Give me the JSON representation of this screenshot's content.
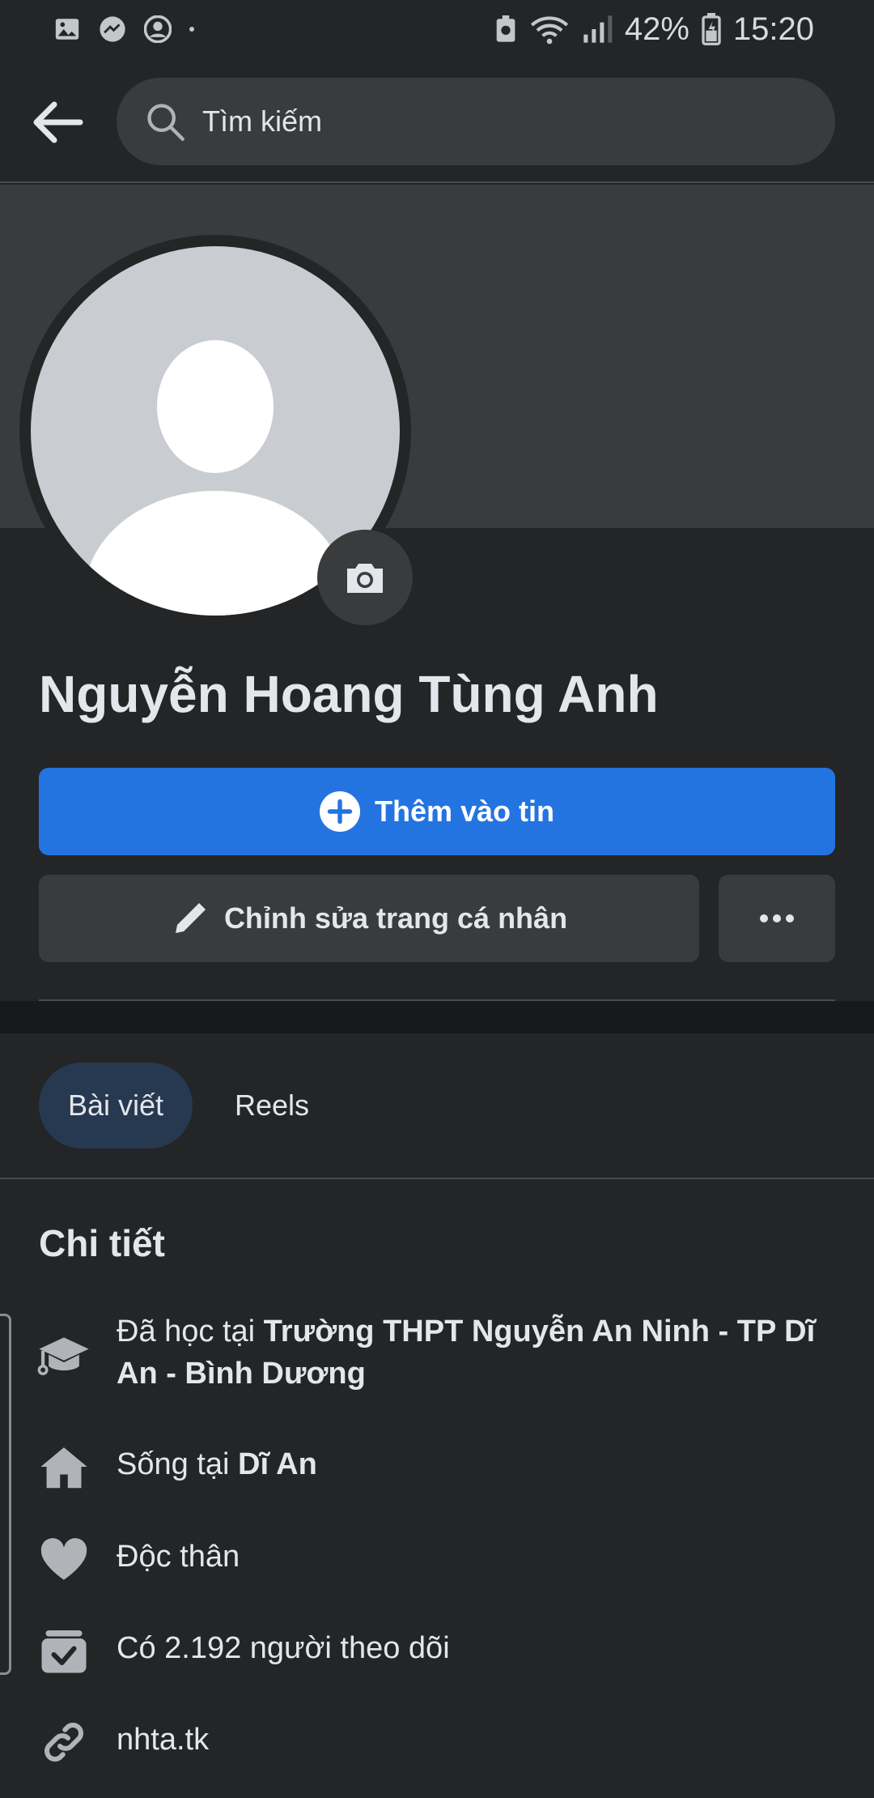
{
  "status_bar": {
    "battery": "42%",
    "time": "15:20"
  },
  "search": {
    "placeholder": "Tìm kiếm"
  },
  "profile": {
    "name": "Nguyễn Hoang Tùng Anh"
  },
  "actions": {
    "add_story": "Thêm vào tin",
    "edit_profile": "Chỉnh sửa trang cá nhân"
  },
  "tabs": [
    {
      "label": "Bài viết"
    },
    {
      "label": "Reels"
    }
  ],
  "details": {
    "title": "Chi tiết",
    "education": {
      "prefix": "Đã học tại ",
      "value": "Trường THPT Nguyễn An Ninh - TP Dĩ An - Bình Dương"
    },
    "lives": {
      "prefix": "Sống tại ",
      "value": "Dĩ An"
    },
    "relationship": "Độc thân",
    "followers": "Có 2.192 người theo dõi",
    "website": "nhta.tk"
  },
  "colors": {
    "background": "#242526",
    "primary_button": "#2374e1",
    "active_tab": "#263951"
  },
  "icons": [
    "image-icon",
    "messenger-icon",
    "account-icon",
    "wifi-icon",
    "signal-icon",
    "battery-icon",
    "back-arrow-icon",
    "search-icon",
    "camera-icon",
    "plus-circle-icon",
    "pencil-icon",
    "more-icon",
    "graduation-cap-icon",
    "home-icon",
    "heart-icon",
    "followers-icon",
    "link-icon"
  ]
}
